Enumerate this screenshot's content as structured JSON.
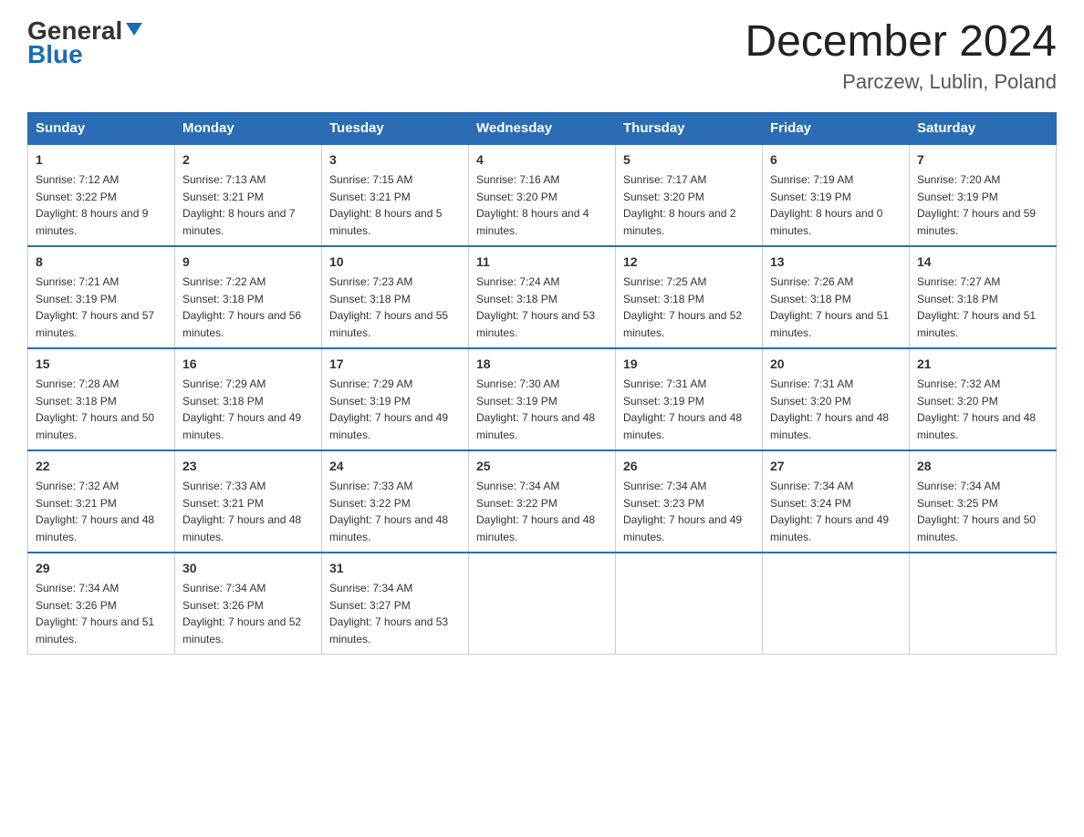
{
  "header": {
    "logo_general": "General",
    "logo_blue": "Blue",
    "month_title": "December 2024",
    "location": "Parczew, Lublin, Poland"
  },
  "days_of_week": [
    "Sunday",
    "Monday",
    "Tuesday",
    "Wednesday",
    "Thursday",
    "Friday",
    "Saturday"
  ],
  "weeks": [
    [
      {
        "day": "1",
        "sunrise": "7:12 AM",
        "sunset": "3:22 PM",
        "daylight": "8 hours and 9 minutes."
      },
      {
        "day": "2",
        "sunrise": "7:13 AM",
        "sunset": "3:21 PM",
        "daylight": "8 hours and 7 minutes."
      },
      {
        "day": "3",
        "sunrise": "7:15 AM",
        "sunset": "3:21 PM",
        "daylight": "8 hours and 5 minutes."
      },
      {
        "day": "4",
        "sunrise": "7:16 AM",
        "sunset": "3:20 PM",
        "daylight": "8 hours and 4 minutes."
      },
      {
        "day": "5",
        "sunrise": "7:17 AM",
        "sunset": "3:20 PM",
        "daylight": "8 hours and 2 minutes."
      },
      {
        "day": "6",
        "sunrise": "7:19 AM",
        "sunset": "3:19 PM",
        "daylight": "8 hours and 0 minutes."
      },
      {
        "day": "7",
        "sunrise": "7:20 AM",
        "sunset": "3:19 PM",
        "daylight": "7 hours and 59 minutes."
      }
    ],
    [
      {
        "day": "8",
        "sunrise": "7:21 AM",
        "sunset": "3:19 PM",
        "daylight": "7 hours and 57 minutes."
      },
      {
        "day": "9",
        "sunrise": "7:22 AM",
        "sunset": "3:18 PM",
        "daylight": "7 hours and 56 minutes."
      },
      {
        "day": "10",
        "sunrise": "7:23 AM",
        "sunset": "3:18 PM",
        "daylight": "7 hours and 55 minutes."
      },
      {
        "day": "11",
        "sunrise": "7:24 AM",
        "sunset": "3:18 PM",
        "daylight": "7 hours and 53 minutes."
      },
      {
        "day": "12",
        "sunrise": "7:25 AM",
        "sunset": "3:18 PM",
        "daylight": "7 hours and 52 minutes."
      },
      {
        "day": "13",
        "sunrise": "7:26 AM",
        "sunset": "3:18 PM",
        "daylight": "7 hours and 51 minutes."
      },
      {
        "day": "14",
        "sunrise": "7:27 AM",
        "sunset": "3:18 PM",
        "daylight": "7 hours and 51 minutes."
      }
    ],
    [
      {
        "day": "15",
        "sunrise": "7:28 AM",
        "sunset": "3:18 PM",
        "daylight": "7 hours and 50 minutes."
      },
      {
        "day": "16",
        "sunrise": "7:29 AM",
        "sunset": "3:18 PM",
        "daylight": "7 hours and 49 minutes."
      },
      {
        "day": "17",
        "sunrise": "7:29 AM",
        "sunset": "3:19 PM",
        "daylight": "7 hours and 49 minutes."
      },
      {
        "day": "18",
        "sunrise": "7:30 AM",
        "sunset": "3:19 PM",
        "daylight": "7 hours and 48 minutes."
      },
      {
        "day": "19",
        "sunrise": "7:31 AM",
        "sunset": "3:19 PM",
        "daylight": "7 hours and 48 minutes."
      },
      {
        "day": "20",
        "sunrise": "7:31 AM",
        "sunset": "3:20 PM",
        "daylight": "7 hours and 48 minutes."
      },
      {
        "day": "21",
        "sunrise": "7:32 AM",
        "sunset": "3:20 PM",
        "daylight": "7 hours and 48 minutes."
      }
    ],
    [
      {
        "day": "22",
        "sunrise": "7:32 AM",
        "sunset": "3:21 PM",
        "daylight": "7 hours and 48 minutes."
      },
      {
        "day": "23",
        "sunrise": "7:33 AM",
        "sunset": "3:21 PM",
        "daylight": "7 hours and 48 minutes."
      },
      {
        "day": "24",
        "sunrise": "7:33 AM",
        "sunset": "3:22 PM",
        "daylight": "7 hours and 48 minutes."
      },
      {
        "day": "25",
        "sunrise": "7:34 AM",
        "sunset": "3:22 PM",
        "daylight": "7 hours and 48 minutes."
      },
      {
        "day": "26",
        "sunrise": "7:34 AM",
        "sunset": "3:23 PM",
        "daylight": "7 hours and 49 minutes."
      },
      {
        "day": "27",
        "sunrise": "7:34 AM",
        "sunset": "3:24 PM",
        "daylight": "7 hours and 49 minutes."
      },
      {
        "day": "28",
        "sunrise": "7:34 AM",
        "sunset": "3:25 PM",
        "daylight": "7 hours and 50 minutes."
      }
    ],
    [
      {
        "day": "29",
        "sunrise": "7:34 AM",
        "sunset": "3:26 PM",
        "daylight": "7 hours and 51 minutes."
      },
      {
        "day": "30",
        "sunrise": "7:34 AM",
        "sunset": "3:26 PM",
        "daylight": "7 hours and 52 minutes."
      },
      {
        "day": "31",
        "sunrise": "7:34 AM",
        "sunset": "3:27 PM",
        "daylight": "7 hours and 53 minutes."
      },
      null,
      null,
      null,
      null
    ]
  ]
}
